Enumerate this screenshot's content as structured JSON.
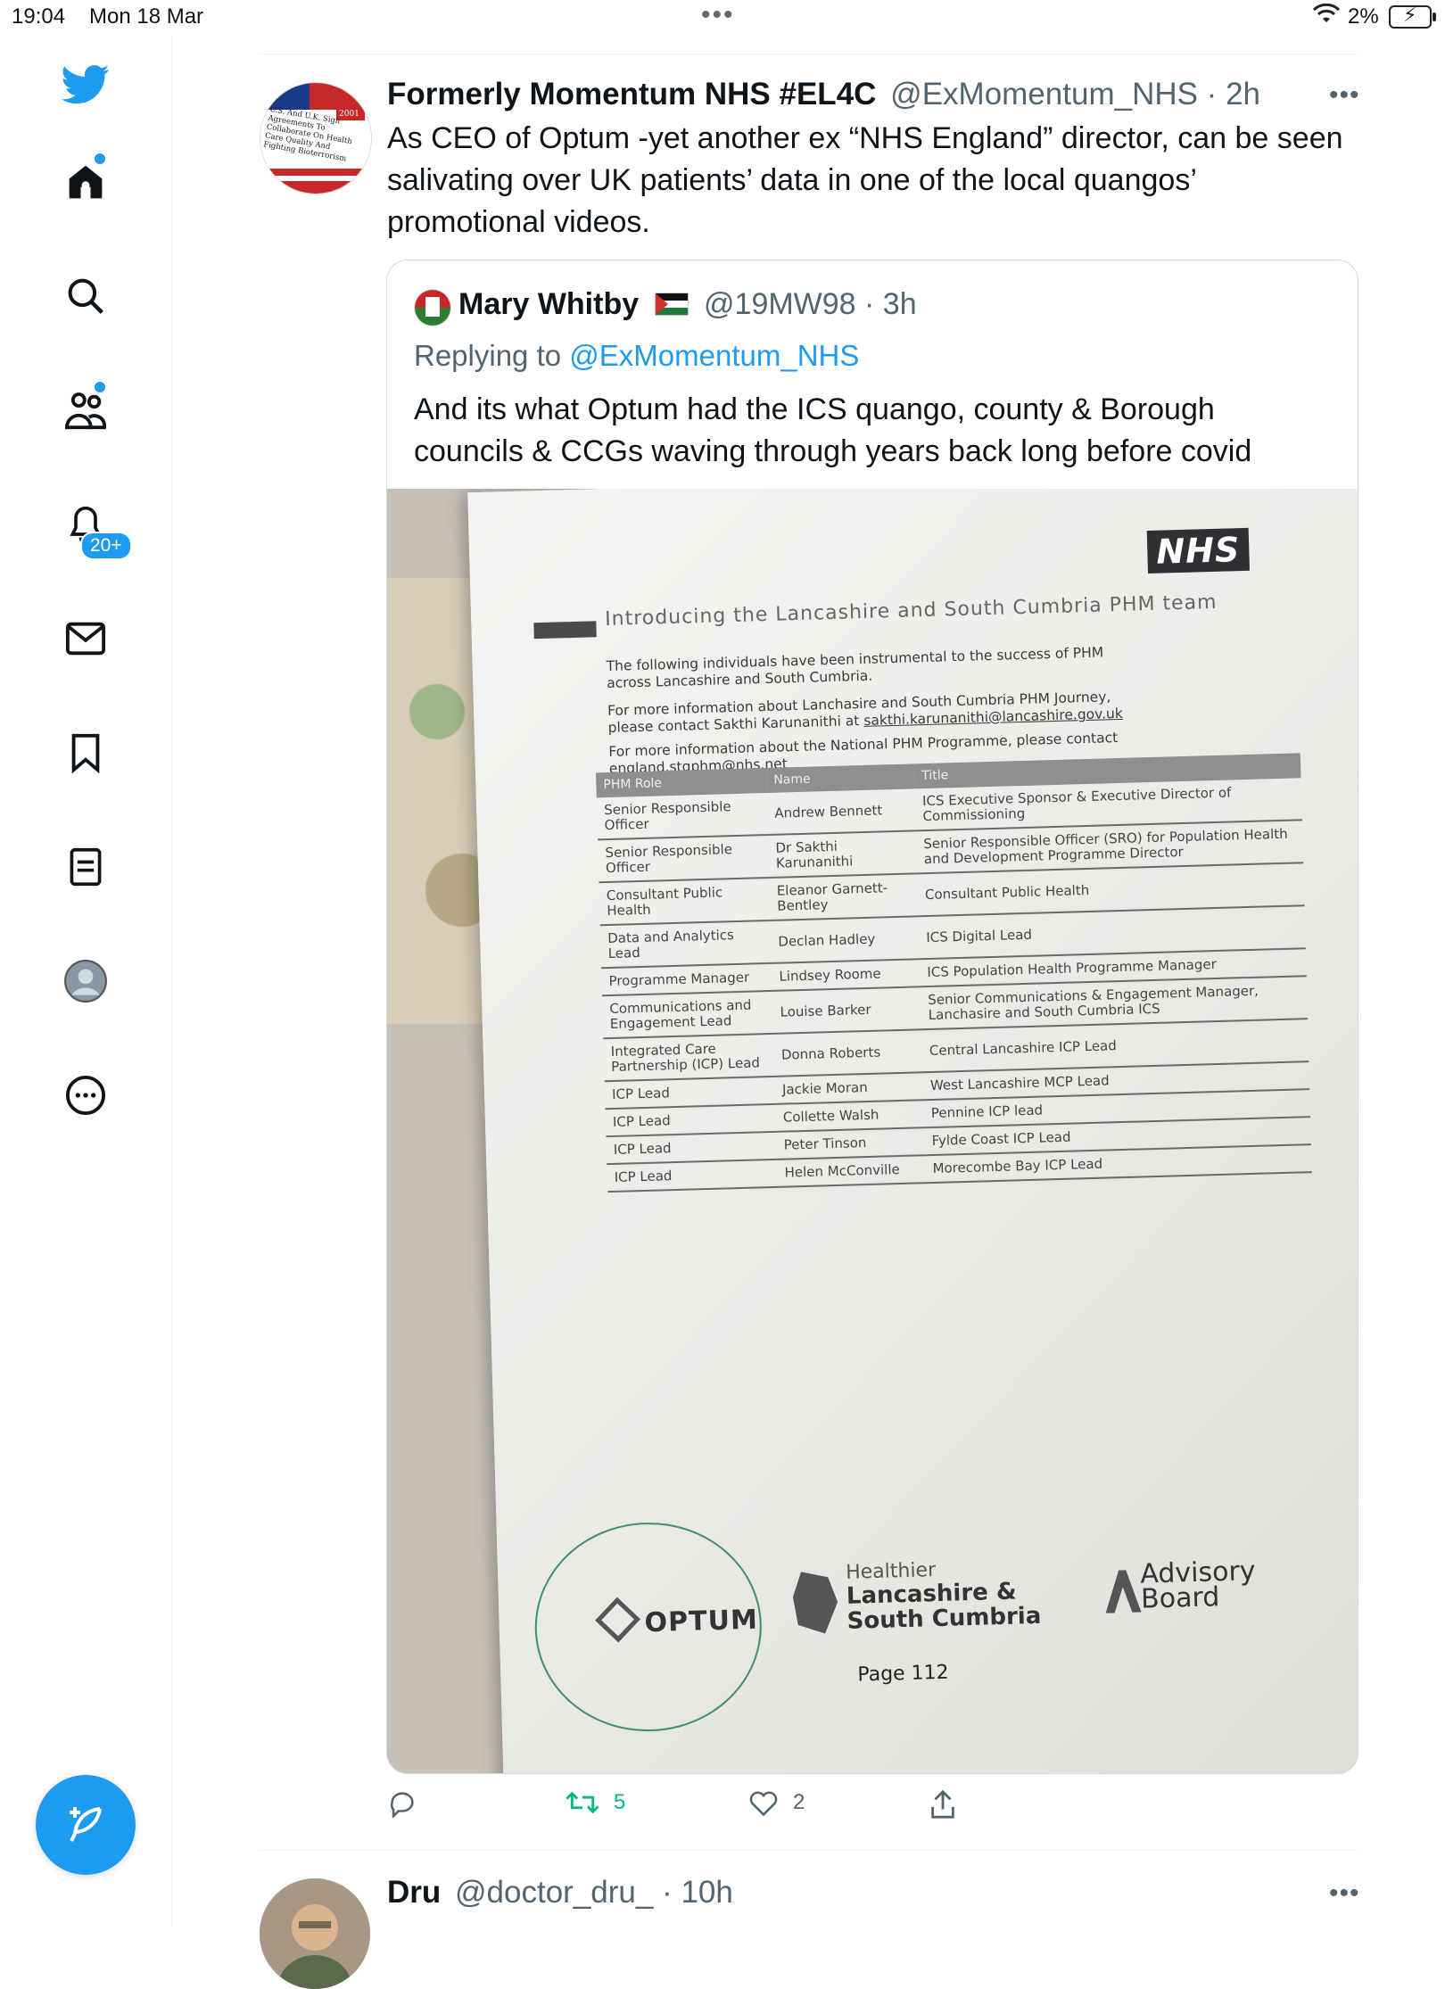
{
  "status_bar": {
    "time": "19:04",
    "date": "Mon 18 Mar",
    "battery_pct": "2%"
  },
  "sidebar": {
    "notifications_badge": "20+",
    "items": [
      {
        "name": "twitter-logo-icon"
      },
      {
        "name": "home-icon"
      },
      {
        "name": "search-icon"
      },
      {
        "name": "communities-icon"
      },
      {
        "name": "notifications-icon"
      },
      {
        "name": "messages-icon"
      },
      {
        "name": "bookmarks-icon"
      },
      {
        "name": "lists-icon"
      },
      {
        "name": "profile-icon"
      },
      {
        "name": "more-icon"
      }
    ],
    "compose_icon": "compose-feather-icon"
  },
  "tweet": {
    "name": "Formerly Momentum NHS #EL4C",
    "handle_time": "@ExMomentum_NHS · 2h",
    "text": "As CEO of Optum -yet another ex “NHS England” director, can be seen salivating over UK patients’ data in one of the local quangos’ promotional videos.",
    "avatar_text": "U.S. And U.K. Sign Agreements To Collaborate On Health Care Quality And Fighting Bioterrorism",
    "avatar_year": "2001",
    "quote": {
      "name": "Mary Whitby",
      "handle_time": "@19MW98 · 3h",
      "replying_prefix": "Replying to",
      "replying_handle": "@ExMomentum_NHS",
      "text": "And its what Optum had the ICS quango, county & Borough councils & CCGs waving through years back long before covid",
      "photo": {
        "logo": "NHS",
        "title": "Introducing the Lancashire and South Cumbria PHM team",
        "para1": "The following individuals have been instrumental to the success of PHM across Lancashire and South Cumbria.",
        "para2_prefix": "For more information about Lanchasire and South Cumbria PHM Journey, please contact Sakthi Karunanithi at",
        "para2_email": "sakthi.karunanithi@lancashire.gov.uk",
        "para3_prefix": "For more information about the National PHM Programme, please contact",
        "para3_email": "england.stgphm@nhs.net",
        "table_headers": [
          "PHM Role",
          "Name",
          "Title"
        ],
        "rows": [
          [
            "Senior Responsible Officer",
            "Andrew Bennett",
            "ICS Executive Sponsor & Executive Director of Commissioning"
          ],
          [
            "Senior Responsible Officer",
            "Dr Sakthi Karunanithi",
            "Senior Responsible Officer (SRO) for Population Health and Development Programme Director"
          ],
          [
            "Consultant Public Health",
            "Eleanor Garnett-Bentley",
            "Consultant Public Health"
          ],
          [
            "Data and Analytics Lead",
            "Declan Hadley",
            "ICS Digital Lead"
          ],
          [
            "Programme Manager",
            "Lindsey Roome",
            "ICS Population Health Programme Manager"
          ],
          [
            "Communications and Engagement Lead",
            "Louise Barker",
            "Senior Communications & Engagement Manager, Lanchasire and South Cumbria ICS"
          ],
          [
            "Integrated Care Partnership (ICP) Lead",
            "Donna Roberts",
            "Central Lancashire ICP Lead"
          ],
          [
            "ICP Lead",
            "Jackie Moran",
            "West Lancashire MCP Lead"
          ],
          [
            "ICP Lead",
            "Collette Walsh",
            "Pennine ICP lead"
          ],
          [
            "ICP Lead",
            "Peter Tinson",
            "Fylde Coast ICP Lead"
          ],
          [
            "ICP Lead",
            "Helen McConville",
            "Morecombe Bay ICP Lead"
          ]
        ],
        "logo_optum": "OPTUM",
        "logo_hlsc_1": "Healthier",
        "logo_hlsc_2": "Lancashire &",
        "logo_hlsc_3": "South Cumbria",
        "logo_advisory_1": "Advisory",
        "logo_advisory_2": "Board",
        "page": "Page 112"
      }
    },
    "actions": {
      "reply_count": "",
      "retweet_count": "5",
      "like_count": "2"
    }
  },
  "tweet2": {
    "name": "Dru",
    "handle_time": "@doctor_dru_ · 10h"
  },
  "colors": {
    "accent": "#1d9bf0",
    "retweet": "#00ba7c",
    "muted": "#536471"
  }
}
